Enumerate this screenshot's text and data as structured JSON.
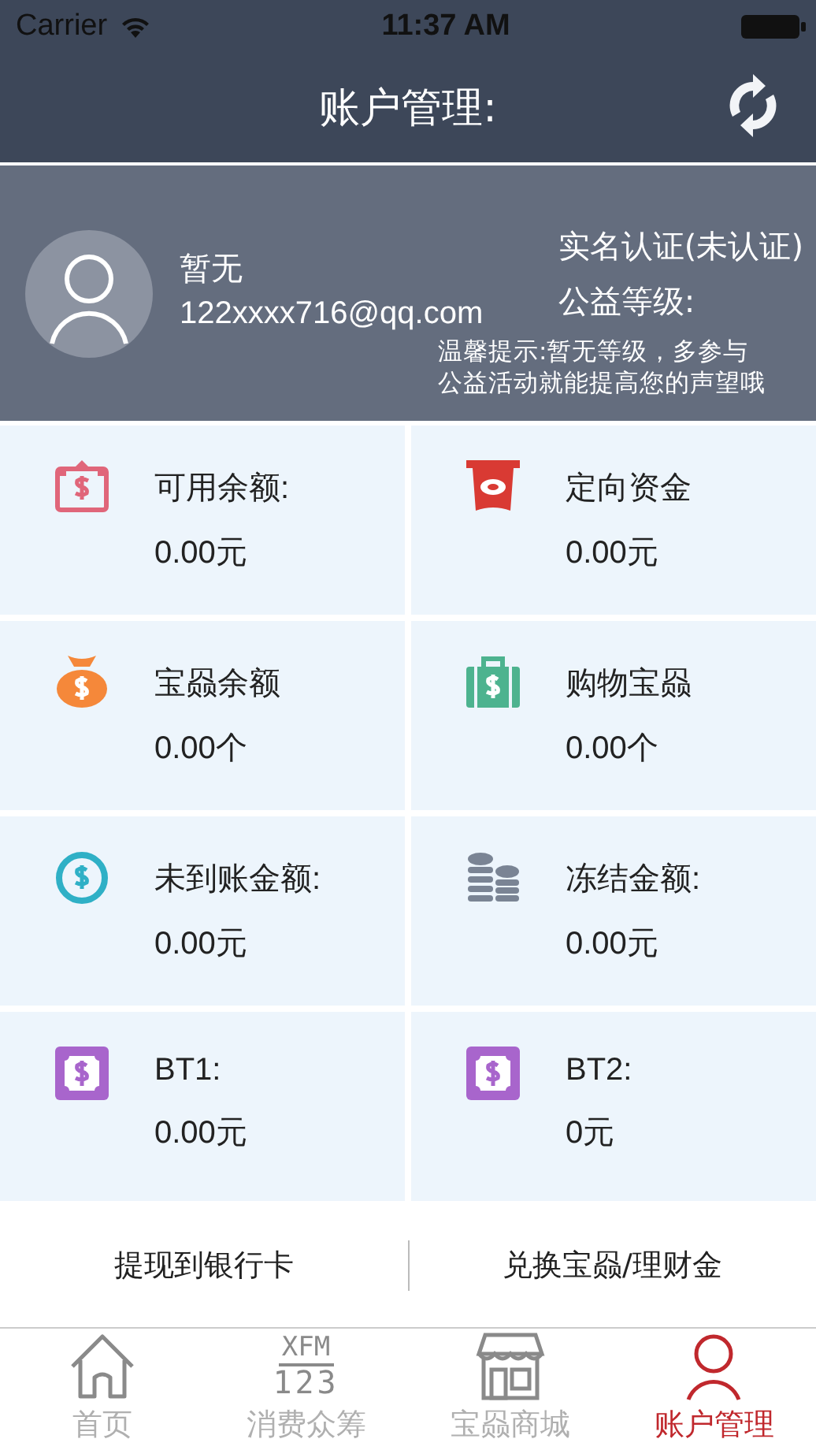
{
  "status_bar": {
    "carrier": "Carrier",
    "time": "11:37 AM"
  },
  "nav": {
    "title": "账户管理:"
  },
  "profile": {
    "name": "暂无",
    "email": "122xxxx716@qq.com",
    "verification": "实名认证(未认证)",
    "level": "公益等级:",
    "tip_lines": [
      "温馨提示:暂无等级，多参与",
      "公益活动就能提高您的声望哦"
    ]
  },
  "accounts": [
    {
      "label": "可用余额:",
      "value": "0.00元"
    },
    {
      "label": "定向资金",
      "value": "0.00元"
    },
    {
      "label": "宝赑余额",
      "value": "0.00个"
    },
    {
      "label": "购物宝赑",
      "value": "0.00个"
    },
    {
      "label": "未到账金额:",
      "value": "0.00元"
    },
    {
      "label": "冻结金额:",
      "value": "0.00元"
    },
    {
      "label": "BT1:",
      "value": "0.00元"
    },
    {
      "label": "BT2:",
      "value": "0元"
    }
  ],
  "actions": [
    "提现到银行卡",
    "兑换宝赑/理财金"
  ],
  "tabs": [
    {
      "label": "首页",
      "selected": false
    },
    {
      "label": "消费众筹",
      "selected": false,
      "icon_text": [
        "XFM",
        "123"
      ]
    },
    {
      "label": "宝赑商城",
      "selected": false
    },
    {
      "label": "账户管理",
      "selected": true
    }
  ]
}
